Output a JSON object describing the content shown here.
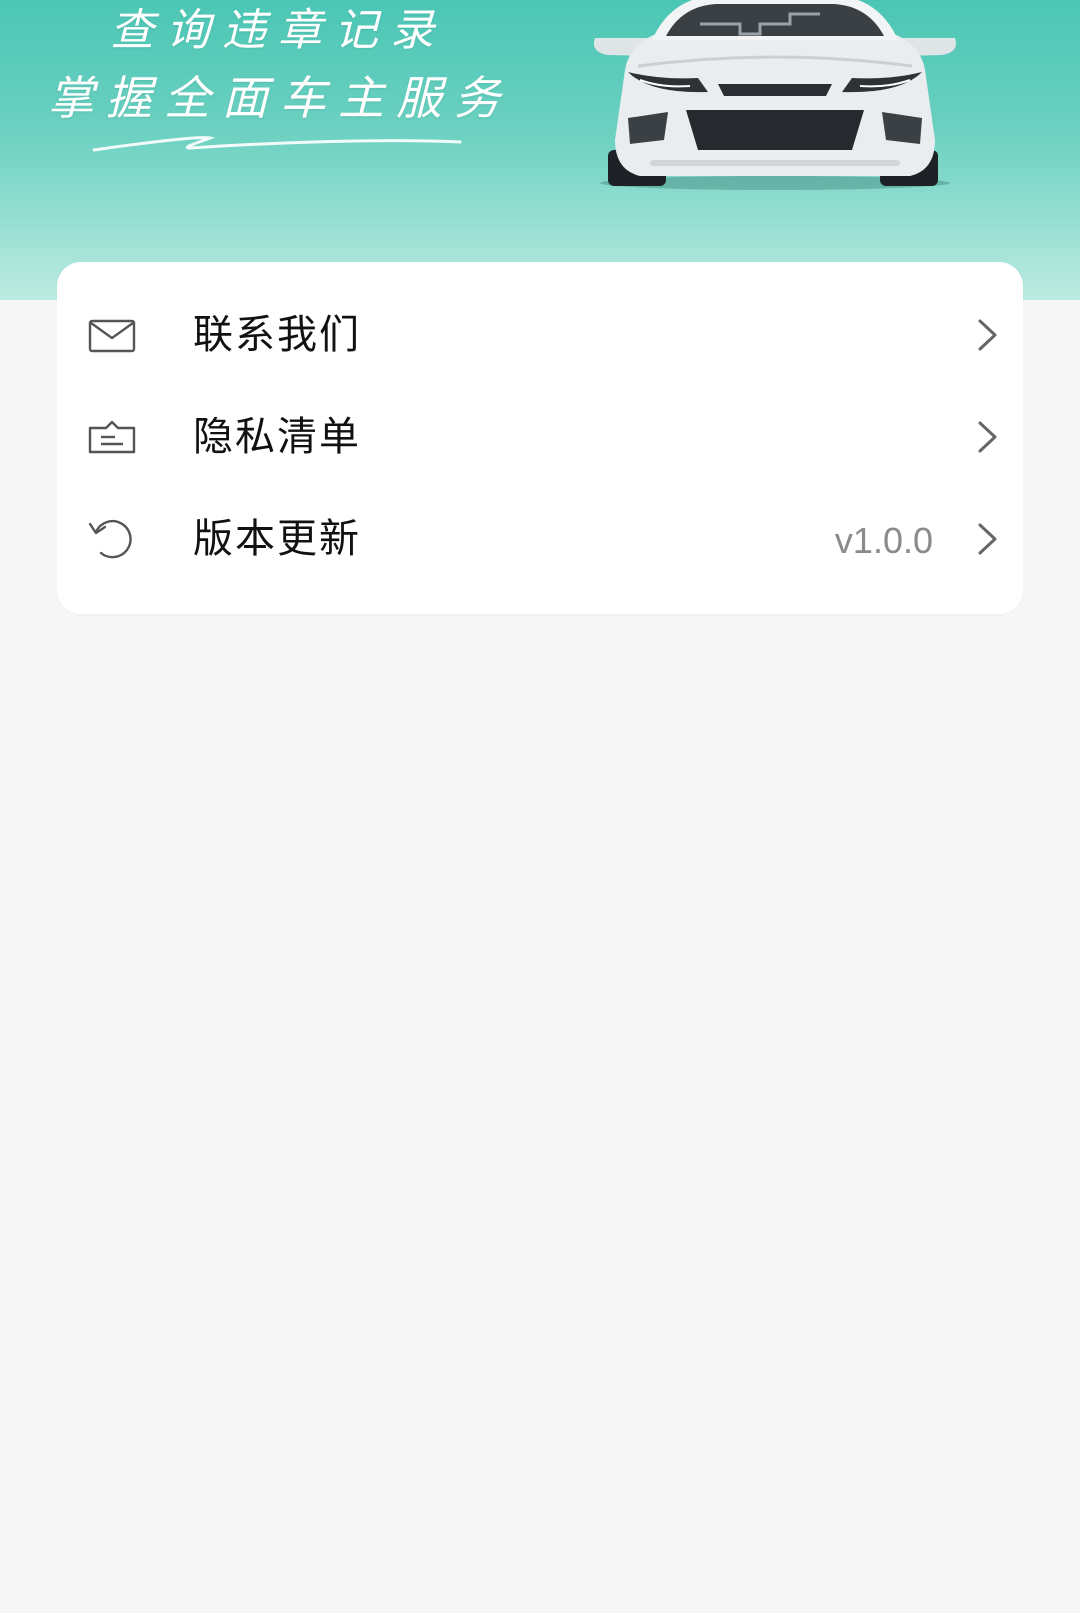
{
  "banner": {
    "slogan_line1": "查询违章记录",
    "slogan_line2": "掌握全面车主服务",
    "colors": {
      "gradient_top": "#4bc6b5",
      "gradient_bottom": "#bdeae0"
    }
  },
  "menu": {
    "items": [
      {
        "icon": "mail-icon",
        "label": "联系我们",
        "value": ""
      },
      {
        "icon": "privacy-list-icon",
        "label": "隐私清单",
        "value": ""
      },
      {
        "icon": "refresh-icon",
        "label": "版本更新",
        "value": "v1.0.0"
      }
    ]
  },
  "colors": {
    "page_background": "#f6f6f6",
    "card_background": "#ffffff",
    "label_text": "#111111",
    "secondary_text": "#8a8a8a"
  }
}
